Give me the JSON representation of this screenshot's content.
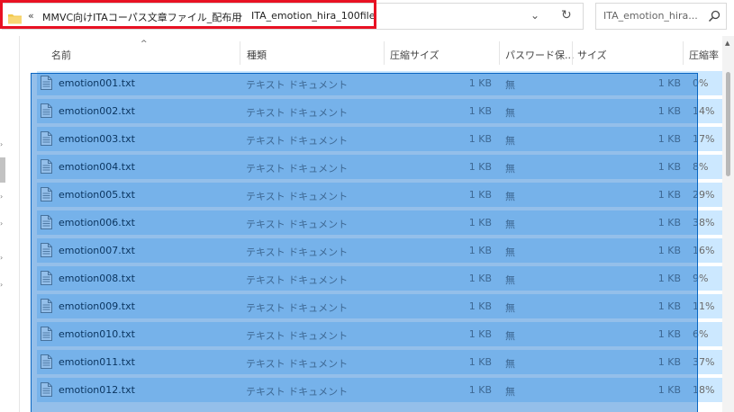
{
  "address": {
    "overflow": "«",
    "crumbs": [
      "MMVC向けITAコーパス文章ファイル_配布用",
      "ITA_emotion_hira_100file"
    ],
    "separator": "›",
    "dropdown": "⌄",
    "refresh": "↻"
  },
  "search": {
    "placeholder": "ITA_emotion_hira..."
  },
  "columns": {
    "name": "名前",
    "type": "種類",
    "compressed_size": "圧縮サイズ",
    "password": "パスワード保...",
    "size": "サイズ",
    "ratio": "圧縮率"
  },
  "files": [
    {
      "name": "emotion001.txt",
      "type": "テキスト ドキュメント",
      "compressed_size": "1 KB",
      "password": "無",
      "size": "1 KB",
      "ratio": "0%"
    },
    {
      "name": "emotion002.txt",
      "type": "テキスト ドキュメント",
      "compressed_size": "1 KB",
      "password": "無",
      "size": "1 KB",
      "ratio": "14%"
    },
    {
      "name": "emotion003.txt",
      "type": "テキスト ドキュメント",
      "compressed_size": "1 KB",
      "password": "無",
      "size": "1 KB",
      "ratio": "17%"
    },
    {
      "name": "emotion004.txt",
      "type": "テキスト ドキュメント",
      "compressed_size": "1 KB",
      "password": "無",
      "size": "1 KB",
      "ratio": "8%"
    },
    {
      "name": "emotion005.txt",
      "type": "テキスト ドキュメント",
      "compressed_size": "1 KB",
      "password": "無",
      "size": "1 KB",
      "ratio": "29%"
    },
    {
      "name": "emotion006.txt",
      "type": "テキスト ドキュメント",
      "compressed_size": "1 KB",
      "password": "無",
      "size": "1 KB",
      "ratio": "38%"
    },
    {
      "name": "emotion007.txt",
      "type": "テキスト ドキュメント",
      "compressed_size": "1 KB",
      "password": "無",
      "size": "1 KB",
      "ratio": "16%"
    },
    {
      "name": "emotion008.txt",
      "type": "テキスト ドキュメント",
      "compressed_size": "1 KB",
      "password": "無",
      "size": "1 KB",
      "ratio": "9%"
    },
    {
      "name": "emotion009.txt",
      "type": "テキスト ドキュメント",
      "compressed_size": "1 KB",
      "password": "無",
      "size": "1 KB",
      "ratio": "11%"
    },
    {
      "name": "emotion010.txt",
      "type": "テキスト ドキュメント",
      "compressed_size": "1 KB",
      "password": "無",
      "size": "1 KB",
      "ratio": "6%"
    },
    {
      "name": "emotion011.txt",
      "type": "テキスト ドキュメント",
      "compressed_size": "1 KB",
      "password": "無",
      "size": "1 KB",
      "ratio": "37%"
    },
    {
      "name": "emotion012.txt",
      "type": "テキスト ドキュメント",
      "compressed_size": "1 KB",
      "password": "無",
      "size": "1 KB",
      "ratio": "18%"
    }
  ],
  "icons": {
    "folder": "folder-icon",
    "file": "text-file-icon",
    "search": "search-icon"
  },
  "colors": {
    "highlight_box": "#e81123",
    "row_selected": "#cce8ff",
    "marquee": "#0a66c2"
  }
}
